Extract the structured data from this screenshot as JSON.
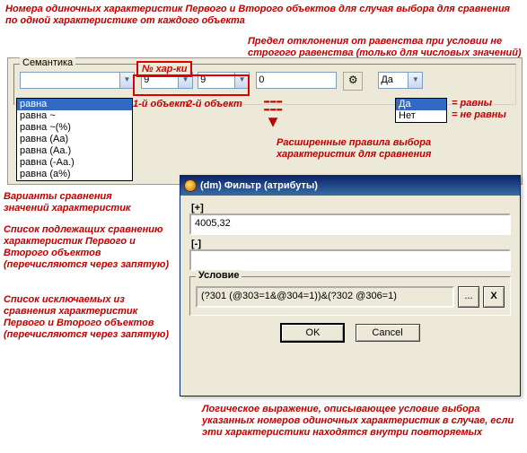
{
  "annotations": {
    "top1": "Номера одиночных характеристик Первого и Второго объектов для случая выбора для сравнения по одной характеристике от каждого объекта",
    "top2": "Предел отклонения от равенства при условии не строгого равенства (только для числовых значений)",
    "obj1": "1-й объект",
    "obj2": "2-й объект",
    "yes_no_eq": "= равны",
    "yes_no_neq": "= не равны",
    "ext_rules": "Расширенные правила выбора характеристик для сравнения",
    "variants": "Варианты сравнения значений характеристик",
    "plus_desc": "Список подлежащих сравнению характеристик Первого и Второго объектов (перечисляются через запятую)",
    "minus_desc": "Список исключаемых из сравнения характеристик Первого и Второго объектов (перечисляются через запятую)",
    "logic": "Логическое выражение, описывающее условие выбора указанных номеров одиночных характеристик в случае, если эти характеристики находятся внутри повторяемых"
  },
  "toolbar": {
    "group_label": "Семантика",
    "hilite_label": "№ хар-ки",
    "combo1_value": "",
    "combo2_value": "9",
    "combo3_value": "9",
    "deviation_value": "0",
    "yesno_selected": "Да"
  },
  "semantics_list": [
    "равна",
    "равна ~",
    "равна ~(%)",
    "равна (Aa)",
    "равна (Aa.)",
    "равна (-Aa.)",
    "равна (a%)"
  ],
  "yesno_list": {
    "option1": "Да",
    "option2": "Нет"
  },
  "dialog": {
    "title": "(dm) Фильтр (атрибуты)",
    "plus_label": "[+]",
    "plus_value": "4005,32",
    "minus_label": "[-]",
    "minus_value": "",
    "condition_label": "Условие",
    "condition_value": "(?301 (@303=1&@304=1))&(?302 @306=1)",
    "more_btn": "...",
    "close_btn": "X",
    "ok": "OK",
    "cancel": "Cancel"
  }
}
